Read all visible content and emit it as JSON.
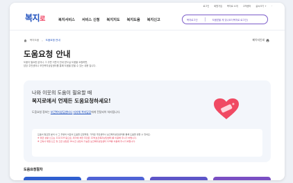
{
  "utility_links": [
    "로그인",
    "회원가입",
    "복지로 소개",
    "고객센터",
    "글씨크기 +",
    "-"
  ],
  "logo": {
    "main": "복지",
    "accent": "로"
  },
  "gnb": [
    "복지서비스",
    "서비스 신청",
    "복지지도",
    "복지도움",
    "복지신고"
  ],
  "login": {
    "left": "복지로그인",
    "right": "도움받을 게 있나요?(복지로 로그인)"
  },
  "breadcrumb": {
    "parent": "복지도움",
    "current": "도움요청 안내"
  },
  "print_label": "페이지인쇄",
  "page_title": "도움요청 안내",
  "intro": [
    "도움이 필요한 분이나 그 주변 이웃이 안내 받으실 도움을 요청하면,",
    "담당 주민센터나 보건복지상담센터를 통해 도움을 받을 수 있는 내용 입니다."
  ],
  "card": {
    "question": "나와 이웃의 도움이 필요할 때",
    "headline": "복지로에서 언제든 도움요청하세요!",
    "sub_prefix": "도움요청 정보는 ",
    "sub_link1": "보건복지상담센터나",
    "sub_mid": " ",
    "sub_link2": "지자체 복지담당",
    "sub_suffix": "에게 전달되어 처리됩니다."
  },
  "notice": {
    "line1": "도움이 필요한 분의 나 그 주변의 이웃이 도움을 요청하면, 가까운 주민센터나 보건복지상담센터를 통해 도움을 받을 수 있어요.",
    "warn1": "※ 위급 상황 신고는 112/119 등으로, 위기에 처한 주민은 129(보건복지상담센터)를 이용해 주시기 바랍니다.",
    "warn2": "※ 고독사 위험 신고 및 긴급 상담은 24시간 상담이 가능한 보건복지상담센터 129를 이용해 주시기 바랍니다."
  },
  "section_title": "도움요청절차",
  "colors": {
    "brand": "#1b4dbc",
    "accent": "#ef3c5c",
    "heart": "#f04a63",
    "tile1": "#2f5fd0",
    "tile2": "#4f63d6",
    "tile3": "#5d55c8",
    "tile4": "#7a4fc3"
  }
}
